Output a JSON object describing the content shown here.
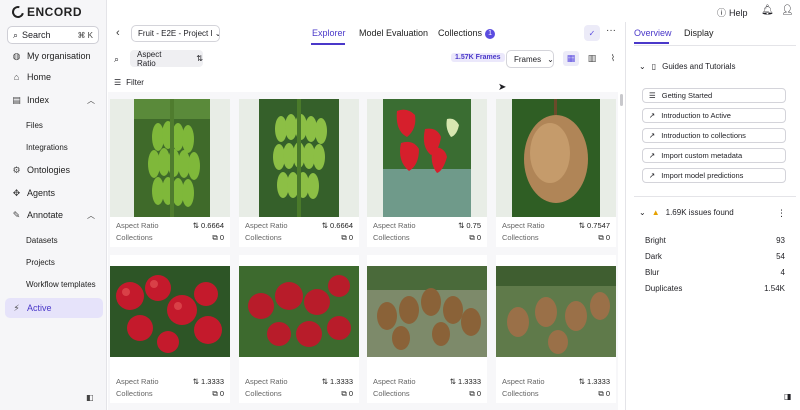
{
  "app": {
    "logo": "ENCORD"
  },
  "sidebar": {
    "search_label": "Search",
    "search_shortcut": "⌘ K",
    "items": [
      {
        "label": "My organisation",
        "icon": "globe-icon"
      },
      {
        "label": "Home",
        "icon": "home-icon"
      },
      {
        "label": "Index",
        "icon": "index-icon"
      },
      {
        "label": "Ontologies",
        "icon": "ontologies-icon"
      },
      {
        "label": "Agents",
        "icon": "agents-icon"
      },
      {
        "label": "Annotate",
        "icon": "annotate-icon"
      },
      {
        "label": "Active",
        "icon": "active-icon"
      }
    ],
    "index_sub": [
      "Files",
      "Integrations"
    ],
    "annotate_sub": [
      "Datasets",
      "Projects",
      "Workflow templates"
    ]
  },
  "header": {
    "help_label": "Help",
    "project_name": "Fruit - E2E - Project I",
    "tabs": [
      {
        "label": "Explorer",
        "active": true
      },
      {
        "label": "Model Evaluation",
        "active": false
      },
      {
        "label": "Collections",
        "active": false,
        "count": "1"
      }
    ]
  },
  "toolbar": {
    "filter_chip": "Aspect Ratio",
    "frames_count": "1.57K Frames",
    "frames_select": "Frames",
    "filter_label": "Filter"
  },
  "grid": {
    "meta_label_1": "Aspect Ratio",
    "meta_label_2": "Collections",
    "cards": [
      {
        "image": "green-bananas",
        "aspect": "0.6664",
        "collections": "0"
      },
      {
        "image": "green-bananas-2",
        "aspect": "0.6664",
        "collections": "0"
      },
      {
        "image": "strawberries",
        "aspect": "0.75",
        "collections": "0"
      },
      {
        "image": "kiwi",
        "aspect": "0.7547",
        "collections": "0"
      },
      {
        "image": "red-apples",
        "aspect": "1.3333",
        "collections": "0"
      },
      {
        "image": "red-apples-2",
        "aspect": "1.3333",
        "collections": "0"
      },
      {
        "image": "kiwi-vine",
        "aspect": "1.3333",
        "collections": "0"
      },
      {
        "image": "kiwi-vine-2",
        "aspect": "1.3333",
        "collections": "0"
      }
    ]
  },
  "right_panel": {
    "tabs": [
      {
        "label": "Overview",
        "active": true
      },
      {
        "label": "Display",
        "active": false
      }
    ],
    "guides_title": "Guides and Tutorials",
    "guides": [
      "Getting Started",
      "Introduction to Active",
      "Introduction to collections",
      "Import custom metadata",
      "Import model predictions"
    ],
    "issues_title": "1.69K issues found",
    "issues": [
      {
        "label": "Bright",
        "value": "93"
      },
      {
        "label": "Dark",
        "value": "54"
      },
      {
        "label": "Blur",
        "value": "4"
      },
      {
        "label": "Duplicates",
        "value": "1.54K"
      }
    ]
  },
  "colors": {
    "accent": "#4a38c9",
    "warning": "#e6a100"
  }
}
